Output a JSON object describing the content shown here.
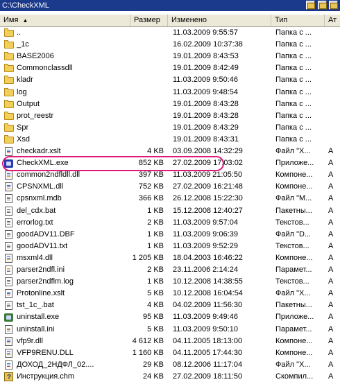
{
  "path_bar": {
    "title": "C:\\CheckXML"
  },
  "columns": [
    "Имя",
    "Размер",
    "Изменено",
    "Тип",
    "Ат"
  ],
  "files": [
    {
      "name": "..",
      "size": "",
      "date": "11.03.2009 9:55:57",
      "type": "Папка с ...",
      "attr": "",
      "icon": "folder-icon"
    },
    {
      "name": "_1c",
      "size": "",
      "date": "16.02.2009 10:37:38",
      "type": "Папка с ...",
      "attr": "",
      "icon": "folder-icon"
    },
    {
      "name": "BASE2006",
      "size": "",
      "date": "19.01.2009 8:43:53",
      "type": "Папка с ...",
      "attr": "",
      "icon": "folder-icon"
    },
    {
      "name": "Commonclassdll",
      "size": "",
      "date": "19.01.2009 8:42:49",
      "type": "Папка с ...",
      "attr": "",
      "icon": "folder-icon"
    },
    {
      "name": "kladr",
      "size": "",
      "date": "11.03.2009 9:50:46",
      "type": "Папка с ...",
      "attr": "",
      "icon": "folder-icon"
    },
    {
      "name": "log",
      "size": "",
      "date": "11.03.2009 9:48:54",
      "type": "Папка с ...",
      "attr": "",
      "icon": "folder-icon"
    },
    {
      "name": "Output",
      "size": "",
      "date": "19.01.2009 8:43:28",
      "type": "Папка с ...",
      "attr": "",
      "icon": "folder-icon"
    },
    {
      "name": "prot_reestr",
      "size": "",
      "date": "19.01.2009 8:43:28",
      "type": "Папка с ...",
      "attr": "",
      "icon": "folder-icon"
    },
    {
      "name": "Spr",
      "size": "",
      "date": "19.01.2009 8:43:29",
      "type": "Папка с ...",
      "attr": "",
      "icon": "folder-icon"
    },
    {
      "name": "Xsd",
      "size": "",
      "date": "19.01.2009 8:43:31",
      "type": "Папка с ...",
      "attr": "",
      "icon": "folder-icon"
    },
    {
      "name": "checkadr.xslt",
      "size": "4 KB",
      "date": "03.09.2008 14:32:29",
      "type": "Файл \"Х...",
      "attr": "A",
      "icon": "xml-file-icon"
    },
    {
      "name": "CheckXML.exe",
      "size": "852 KB",
      "date": "27.02.2009 17:03:02",
      "type": "Приложе...",
      "attr": "A",
      "icon": "exe-file-icon"
    },
    {
      "name": "common2ndfldll.dll",
      "size": "397 KB",
      "date": "11.03.2009 21:05:50",
      "type": "Компоне...",
      "attr": "A",
      "icon": "dll-file-icon"
    },
    {
      "name": "CPSNXML.dll",
      "size": "752 KB",
      "date": "27.02.2009 16:21:48",
      "type": "Компоне...",
      "attr": "A",
      "icon": "dll-file-icon"
    },
    {
      "name": "cpsnxml.mdb",
      "size": "366 KB",
      "date": "26.12.2008 15:22:30",
      "type": "Файл \"М...",
      "attr": "A",
      "icon": "mdb-file-icon"
    },
    {
      "name": "del_cdx.bat",
      "size": "1 KB",
      "date": "15.12.2008 12:40:27",
      "type": "Пакетны...",
      "attr": "A",
      "icon": "bat-file-icon"
    },
    {
      "name": "errorlog.txt",
      "size": "2 KB",
      "date": "11.03.2009 9:57:04",
      "type": "Текстов...",
      "attr": "A",
      "icon": "text-file-icon"
    },
    {
      "name": "goodADV11.DBF",
      "size": "1 KB",
      "date": "11.03.2009 9:06:39",
      "type": "Файл \"D...",
      "attr": "A",
      "icon": "dbf-file-icon"
    },
    {
      "name": "goodADV11.txt",
      "size": "1 KB",
      "date": "11.03.2009 9:52:29",
      "type": "Текстов...",
      "attr": "A",
      "icon": "text-file-icon"
    },
    {
      "name": "msxml4.dll",
      "size": "1 205 KB",
      "date": "18.04.2003 16:46:22",
      "type": "Компоне...",
      "attr": "A",
      "icon": "dll-file-icon"
    },
    {
      "name": "parser2ndfl.ini",
      "size": "2 KB",
      "date": "23.11.2006 2:14:24",
      "type": "Парамет...",
      "attr": "A",
      "icon": "ini-file-icon"
    },
    {
      "name": "parser2ndflm.log",
      "size": "1 KB",
      "date": "10.12.2008 14:38:55",
      "type": "Текстов...",
      "attr": "A",
      "icon": "text-file-icon"
    },
    {
      "name": "Protonline.xslt",
      "size": "5 KB",
      "date": "10.12.2008 16:04:54",
      "type": "Файл \"Х...",
      "attr": "A",
      "icon": "xml-file-icon"
    },
    {
      "name": "tst_1c_.bat",
      "size": "4 KB",
      "date": "04.02.2009 11:56:30",
      "type": "Пакетны...",
      "attr": "A",
      "icon": "bat-file-icon"
    },
    {
      "name": "uninstall.exe",
      "size": "95 KB",
      "date": "11.03.2009 9:49:46",
      "type": "Приложе...",
      "attr": "A",
      "icon": "setup-exe-icon"
    },
    {
      "name": "uninstall.ini",
      "size": "5 KB",
      "date": "11.03.2009 9:50:10",
      "type": "Парамет...",
      "attr": "A",
      "icon": "ini-file-icon"
    },
    {
      "name": "vfp9r.dll",
      "size": "4 612 KB",
      "date": "04.11.2005 18:13:00",
      "type": "Компоне...",
      "attr": "A",
      "icon": "dll-file-icon"
    },
    {
      "name": "VFP9RENU.DLL",
      "size": "1 160 KB",
      "date": "04.11.2005 17:44:30",
      "type": "Компоне...",
      "attr": "A",
      "icon": "dll-file-icon"
    },
    {
      "name": "ДОХОД_2НДФЛ_02....",
      "size": "29 KB",
      "date": "08.12.2006 11:17:04",
      "type": "Файл \"Х...",
      "attr": "A",
      "icon": "xml-file-icon"
    },
    {
      "name": "Инструкция.chm",
      "size": "24 KB",
      "date": "27.02.2009 18:11:50",
      "type": "Скомпил...",
      "attr": "A",
      "icon": "chm-file-icon"
    }
  ],
  "colors": {
    "highlight_mark": "#e0187a",
    "path_bar": "#1b3a8c"
  }
}
